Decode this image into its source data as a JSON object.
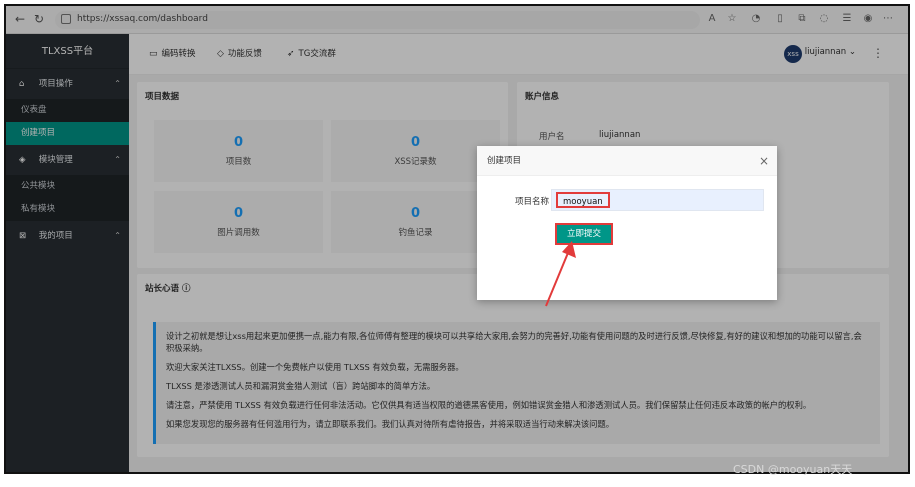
{
  "browser": {
    "url": "https://xssaq.com/dashboard",
    "back_icon": "back-arrow-icon",
    "forward_icon": "forward-arrow-icon",
    "refresh_icon": "refresh-icon"
  },
  "sidebar": {
    "brand": "TLXSS平台",
    "groups": [
      {
        "label": "项目操作",
        "items": [
          "仪表盘",
          "创建项目"
        ]
      },
      {
        "label": "模块管理",
        "items": [
          "公共模块",
          "私有模块"
        ]
      },
      {
        "label": "我的项目",
        "items": []
      }
    ],
    "active_item": "创建项目"
  },
  "header": {
    "tabs": [
      "编码转换",
      "功能反馈",
      "TG交流群"
    ],
    "username": "liujiannan"
  },
  "project_data": {
    "title": "项目数据",
    "stats": [
      {
        "value": "0",
        "label": "项目数"
      },
      {
        "value": "0",
        "label": "XSS记录数"
      },
      {
        "value": "0",
        "label": "图片调用数"
      },
      {
        "value": "0",
        "label": "钓鱼记录"
      }
    ]
  },
  "account": {
    "title": "账户信息",
    "username_label": "用户名",
    "username_value": "liujiannan"
  },
  "message": {
    "title": "站长心语",
    "paragraphs": [
      "设计之初就是想让xss用起来更加便携一点,能力有限,各位师傅有整理的模块可以共享给大家用,会努力的完善好,功能有使用问题的及时进行反馈,尽快修复,有好的建议和想加的功能可以留言,会积极采纳。",
      "欢迎大家关注TLXSS。创建一个免费帐户以使用 TLXSS 有效负载，无需服务器。",
      "TLXSS 是渗透测试人员和漏洞赏金猎人测试（盲）跨站脚本的简单方法。",
      "请注意，严禁使用 TLXSS 有效负载进行任何非法活动。它仅供具有适当权限的道德黑客使用，例如错误赏金猎人和渗透测试人员。我们保留禁止任何违反本政策的帐户的权利。",
      "如果您发现您的服务器有任何滥用行为，请立即联系我们。我们认真对待所有虐待报告，并将采取适当行动来解决该问题。"
    ]
  },
  "modal": {
    "title": "创建项目",
    "field_label": "项目名称",
    "field_value": "mooyuan",
    "submit_label": "立即提交"
  },
  "watermark": "CSDN @mooyuan天天",
  "colors": {
    "accent": "#009688",
    "stat_number": "#1e9fff",
    "highlight": "#e23b3b",
    "sidebar_bg": "#292f34"
  }
}
